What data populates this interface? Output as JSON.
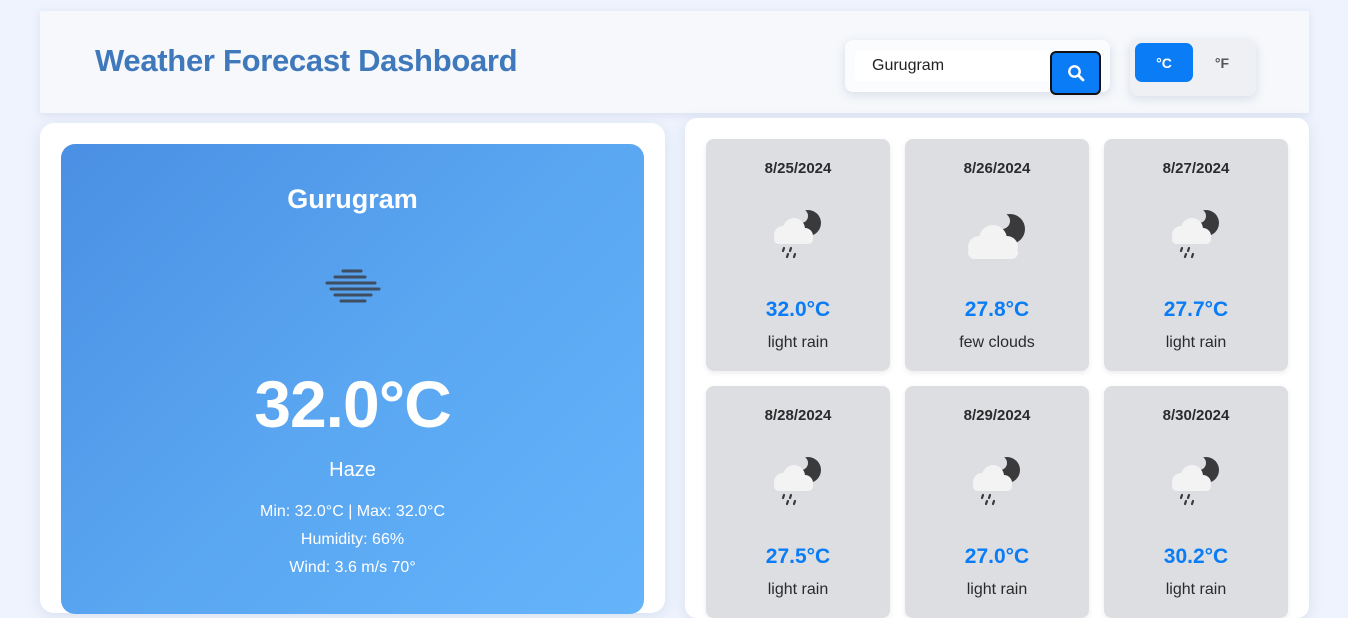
{
  "header": {
    "title": "Weather Forecast Dashboard",
    "search": {
      "value": "Gurugram",
      "placeholder": ""
    },
    "search_button_icon": "search-icon",
    "units": {
      "celsius": "°C",
      "fahrenheit": "°F",
      "active": "celsius"
    }
  },
  "current": {
    "city": "Gurugram",
    "icon": "haze-icon",
    "temp": "32.0°C",
    "description": "Haze",
    "minmax": "Min: 32.0°C | Max: 32.0°C",
    "humidity": "Humidity: 66%",
    "wind": "Wind: 3.6 m/s 70°"
  },
  "forecast": [
    {
      "date": "8/25/2024",
      "icon": "rain-night-icon",
      "temp": "32.0°C",
      "description": "light rain"
    },
    {
      "date": "8/26/2024",
      "icon": "cloud-night-icon",
      "temp": "27.8°C",
      "description": "few clouds"
    },
    {
      "date": "8/27/2024",
      "icon": "rain-night-icon",
      "temp": "27.7°C",
      "description": "light rain"
    },
    {
      "date": "8/28/2024",
      "icon": "rain-night-icon",
      "temp": "27.5°C",
      "description": "light rain"
    },
    {
      "date": "8/29/2024",
      "icon": "rain-night-icon",
      "temp": "27.0°C",
      "description": "light rain"
    },
    {
      "date": "8/30/2024",
      "icon": "rain-night-icon",
      "temp": "30.2°C",
      "description": "light rain"
    }
  ],
  "colors": {
    "accent": "#0a7cf5",
    "title": "#3f78bb",
    "card_gradient_start": "#4a8fe3",
    "card_gradient_end": "#64b4fb",
    "forecast_card": "#dcdee2"
  }
}
